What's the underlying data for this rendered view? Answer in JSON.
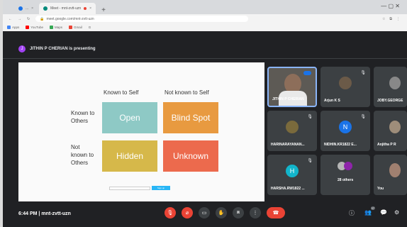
{
  "browser": {
    "tabs": [
      {
        "label": "...",
        "active": false
      },
      {
        "label": "Meet - mnt-zvtt-uzn",
        "active": true
      }
    ],
    "url": "meet.google.com/mnt-zvtt-uzn",
    "bookmarks": [
      {
        "label": "Apps",
        "icon": "apps-icon",
        "color": "#4285f4"
      },
      {
        "label": "YouTube",
        "icon": "youtube-icon",
        "color": "#ff0000"
      },
      {
        "label": "Maps",
        "icon": "maps-icon",
        "color": "#34a853"
      },
      {
        "label": "Gmail",
        "icon": "gmail-icon",
        "color": "#ea4335"
      },
      {
        "label": "G",
        "icon": "google-icon",
        "color": "#4285f4"
      }
    ]
  },
  "presenting": {
    "initial": "J",
    "text": "JITHIN P CHERIAN is presenting"
  },
  "slide": {
    "col_known": "Known to Self",
    "col_not_known": "Not known to Self",
    "row_known": [
      "Known to",
      "Others"
    ],
    "row_not_known": [
      "Not",
      "known to",
      "Others"
    ],
    "boxes": {
      "open": "Open",
      "blind": "Blind Spot",
      "hidden": "Hidden",
      "unknown": "Unknown"
    },
    "footer_field": "...",
    "footer_button": "Sign up"
  },
  "participants": [
    {
      "name": "JITHIN P CHERIAN",
      "type": "video"
    },
    {
      "name": "Arjun K S",
      "type": "photo"
    },
    {
      "name": "JOBY.GEORGE",
      "type": "photo"
    },
    {
      "name": "HARINARAYANAN...",
      "type": "photo"
    },
    {
      "name": "NIDHIN.KR1822 E...",
      "type": "initial",
      "initial": "N",
      "color": "#1a73e8"
    },
    {
      "name": "Anjitha P R",
      "type": "photo"
    },
    {
      "name": "HARSHA.RW1822 ...",
      "type": "initial",
      "initial": "H",
      "color": "#12b5cb"
    },
    {
      "name": "28 others",
      "type": "others"
    },
    {
      "name": "You",
      "type": "photo"
    }
  ],
  "bottom": {
    "time": "6:44 PM",
    "meeting_code": "mnt-zvtt-uzn",
    "separator": "|",
    "participant_count": "37"
  },
  "colors": {
    "meet_bg": "#202124",
    "tile_bg": "#3c4043",
    "danger": "#ea4335",
    "accent": "#8ab4f8"
  }
}
